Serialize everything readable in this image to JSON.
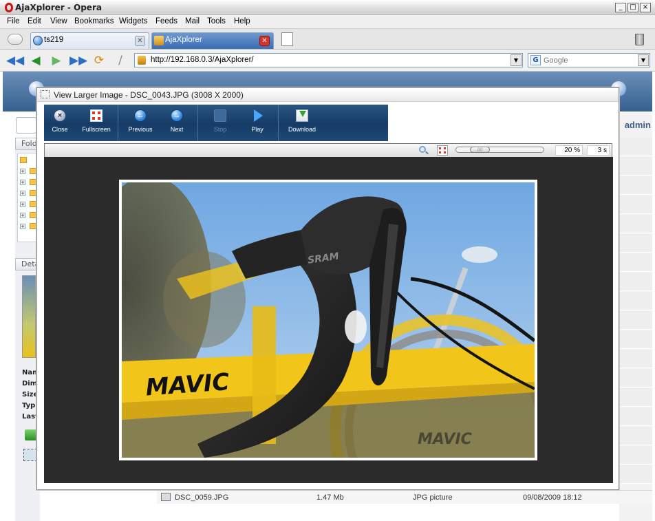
{
  "window": {
    "title": "AjaXplorer - Opera",
    "controls": [
      "_",
      "□",
      "×"
    ]
  },
  "menu": [
    "File",
    "Edit",
    "View",
    "Bookmarks",
    "Widgets",
    "Feeds",
    "Mail",
    "Tools",
    "Help"
  ],
  "tabs": [
    {
      "label": "ts219",
      "active": false
    },
    {
      "label": "AjaXplorer",
      "active": true
    }
  ],
  "address": {
    "url": "http://192.168.0.3/AjaXplorer/"
  },
  "search": {
    "placeholder": "Google",
    "engine_icon": "G"
  },
  "background_app": {
    "user": "admin",
    "left_panels": {
      "folders_label": "Fold",
      "details_label": "Deta",
      "detail_fields": [
        "Nam",
        "Dim",
        "Size",
        "Typ",
        "Last"
      ]
    },
    "file_row": {
      "name": "DSC_0059.JPG",
      "size": "1.47 Mb",
      "type": "JPG picture",
      "modified": "09/08/2009 18:12"
    }
  },
  "viewer": {
    "title": "View Larger Image - DSC_0043.JPG (3008 X 2000)",
    "buttons": {
      "close": "Close",
      "fullscreen": "Fullscreen",
      "previous": "Previous",
      "next": "Next",
      "stop": "Stop",
      "play": "Play",
      "download": "Download"
    },
    "zoom": "20 %",
    "zoom_level": 0.2,
    "slideshow_delay": "3 s"
  },
  "photo": {
    "brand_text": "MAVIC",
    "lever_text": "SRAM"
  },
  "colors": {
    "toolbar_blue": "#163b66",
    "stage": "#2b2b2b",
    "rim_yellow": "#f2c51a"
  }
}
